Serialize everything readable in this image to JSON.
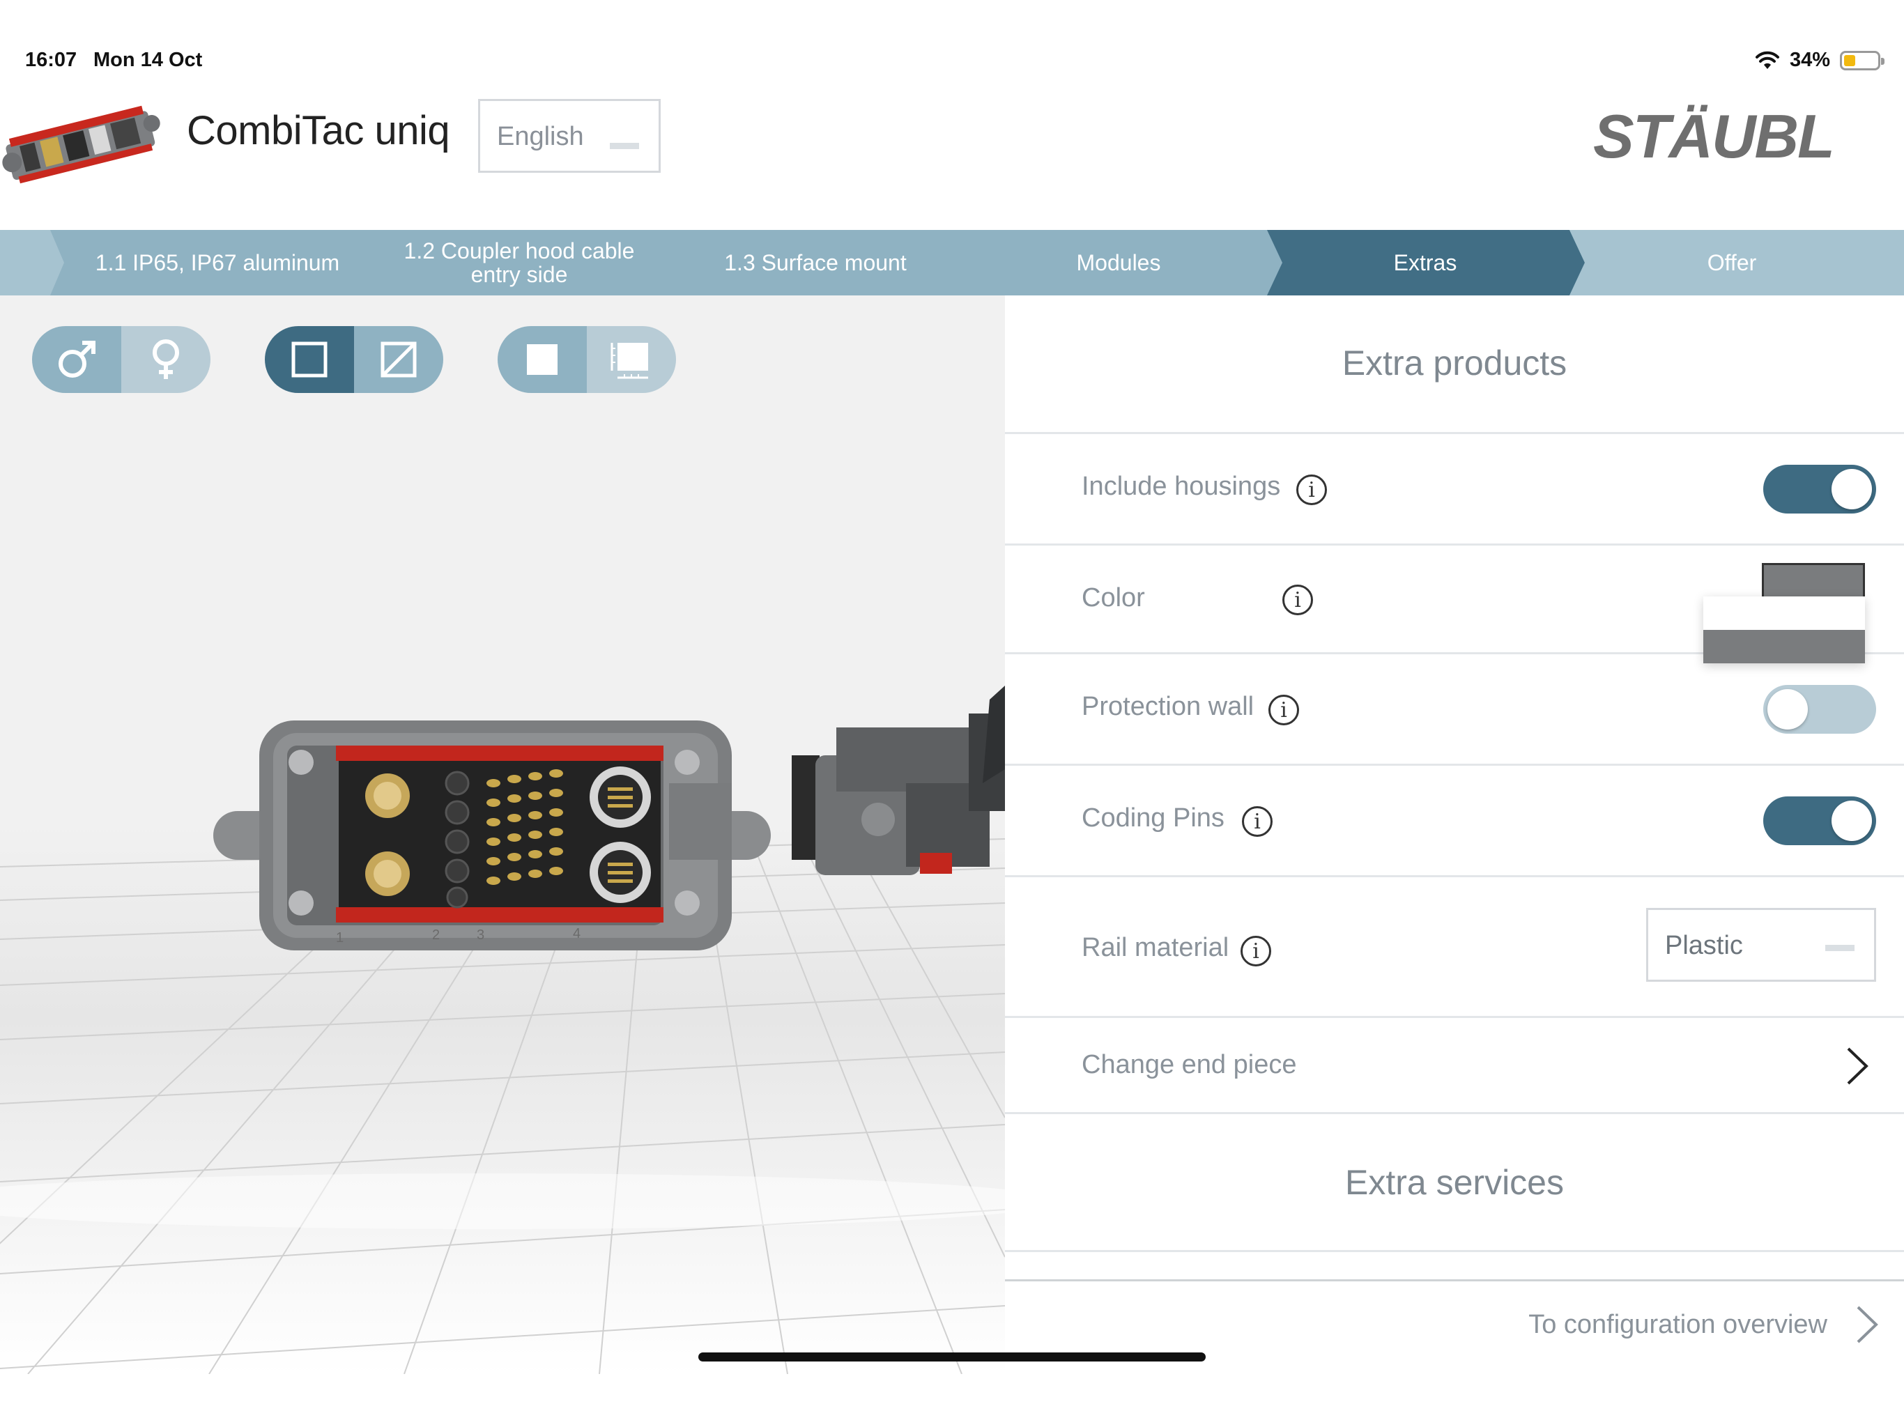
{
  "status_bar": {
    "time": "16:07",
    "date": "Mon 14 Oct",
    "battery_percent": "34%",
    "battery_level": 0.34,
    "icons": [
      "wifi-icon",
      "battery-icon"
    ]
  },
  "header": {
    "app_title": "CombiTac uniq",
    "language": "English",
    "brand": "STÄUBLI"
  },
  "steps": [
    {
      "label": "1.1 IP65, IP67 aluminum",
      "active": false
    },
    {
      "label": "1.2 Coupler hood cable entry side",
      "active": false
    },
    {
      "label": "1.3 Surface mount",
      "active": false
    },
    {
      "label": "Modules",
      "active": false
    },
    {
      "label": "Extras",
      "active": true
    },
    {
      "label": "Offer",
      "active": false
    }
  ],
  "viewer": {
    "toggle_groups": [
      {
        "left_icon": "male-symbol-icon",
        "right_icon": "female-symbol-icon",
        "selected": "left"
      },
      {
        "left_icon": "square-icon",
        "right_icon": "square-slash-icon",
        "selected": "left"
      },
      {
        "left_icon": "filled-square-icon",
        "right_icon": "square-ruler-icon",
        "selected": "left"
      }
    ],
    "connector_markings": [
      "1",
      "2",
      "3",
      "4"
    ]
  },
  "panel": {
    "extra_products_title": "Extra products",
    "rows": {
      "include_housings": {
        "label": "Include housings",
        "on": true
      },
      "color": {
        "label": "Color",
        "options": [
          "#ffffff",
          "#7a7c7e"
        ],
        "selected": "#7a7c7e"
      },
      "protection_wall": {
        "label": "Protection wall",
        "on": false
      },
      "coding_pins": {
        "label": "Coding Pins",
        "on": true
      },
      "rail_material": {
        "label": "Rail material",
        "value": "Plastic"
      },
      "change_end_piece": {
        "label": "Change end piece"
      }
    },
    "extra_services_title": "Extra services",
    "footer_link": "To configuration overview"
  },
  "colors": {
    "accent_dark": "#3e6b82",
    "accent_light": "#8fb2c2",
    "toggle_off": "#b8ccd6"
  }
}
